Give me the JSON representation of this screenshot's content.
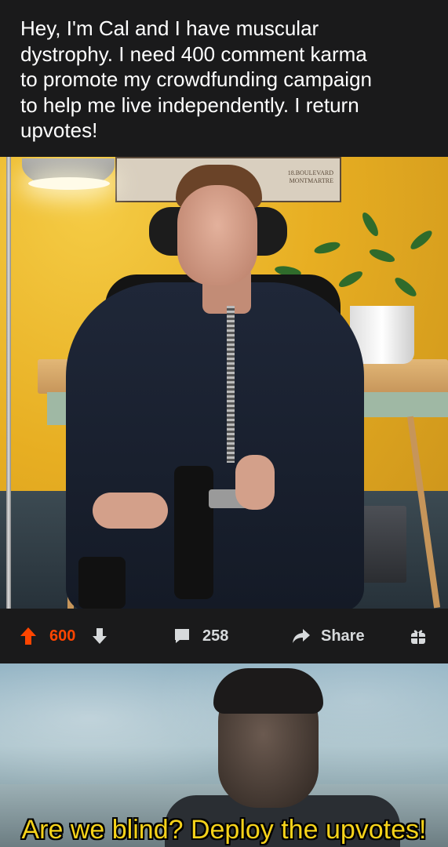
{
  "post": {
    "title_lines": [
      "Hey, I'm Cal and I have muscular",
      "dystrophy. I need 400 comment karma",
      "to promote my crowdfunding campaign",
      "to help me live independently. I return",
      "upvotes!"
    ],
    "photo_poster_text": [
      "18.BOULEVARD",
      "MONTMARTRE"
    ]
  },
  "actions": {
    "vote_count": "600",
    "comment_count": "258",
    "share_label": "Share",
    "icons": {
      "upvote": "upvote-arrow-icon",
      "downvote": "downvote-arrow-icon",
      "comment": "comment-bubble-icon",
      "share": "share-arrow-icon",
      "award": "gift-award-icon"
    },
    "colors": {
      "upvoted": "#ff4500",
      "text": "#d7dadc",
      "background": "#1a1a1b"
    }
  },
  "meme": {
    "caption": "Are we blind? Deploy the upvotes!",
    "caption_color": "#f5d21a"
  }
}
